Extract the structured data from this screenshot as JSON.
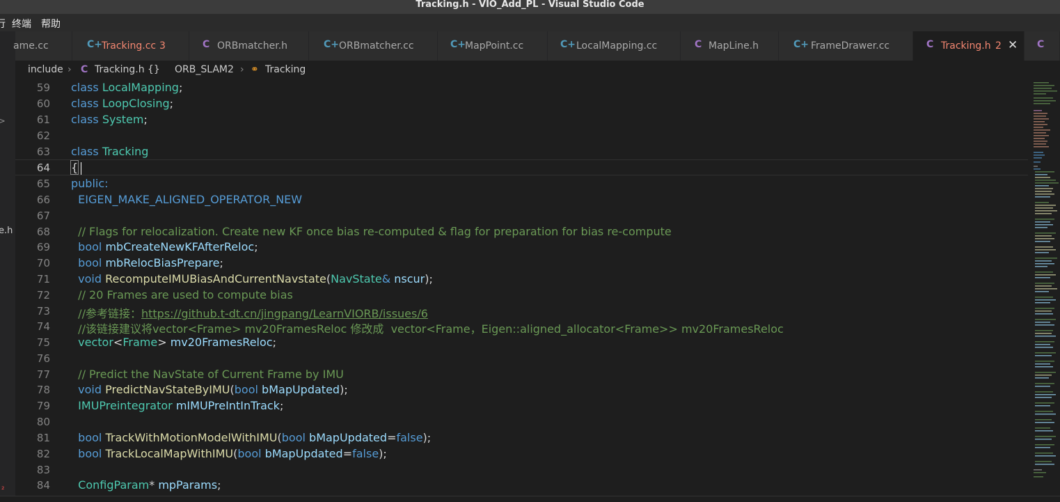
{
  "window": {
    "title": "Tracking.h - VIO_Add_PL - Visual Studio Code"
  },
  "menu": {
    "items": [
      "行",
      "终端",
      "帮助"
    ]
  },
  "left_panel": {
    "fragments": [
      ">",
      "e.h",
      "₂"
    ]
  },
  "tabs": [
    {
      "icon": "",
      "label": "ame.cc",
      "count": ""
    },
    {
      "icon": "C+",
      "label": "Tracking.cc",
      "count": "3"
    },
    {
      "icon": "C",
      "label": "ORBmatcher.h",
      "count": ""
    },
    {
      "icon": "C+",
      "label": "ORBmatcher.cc",
      "count": ""
    },
    {
      "icon": "C+",
      "label": "MapPoint.cc",
      "count": ""
    },
    {
      "icon": "C+",
      "label": "LocalMapping.cc",
      "count": ""
    },
    {
      "icon": "C",
      "label": "MapLine.h",
      "count": ""
    },
    {
      "icon": "C+",
      "label": "FrameDrawer.cc",
      "count": ""
    },
    {
      "icon": "C",
      "label": "Tracking.h",
      "count": "2"
    },
    {
      "icon": "C",
      "label": "",
      "count": ""
    }
  ],
  "breadcrumb": {
    "folder": "include",
    "file_icon": "C",
    "file": "Tracking.h",
    "ns_icon": "{}",
    "namespace": "ORB_SLAM2",
    "class_icon": "⚭",
    "class": "Tracking"
  },
  "editor": {
    "line_numbers": [
      "59",
      "60",
      "61",
      "62",
      "63",
      "64",
      "65",
      "66",
      "67",
      "68",
      "69",
      "70",
      "71",
      "72",
      "73",
      "74",
      "75",
      "76",
      "77",
      "78",
      "79",
      "80",
      "81",
      "82",
      "83",
      "84"
    ],
    "current_line": "64",
    "lines": [
      [
        "class ",
        "LocalMapping",
        ";"
      ],
      [
        "class ",
        "LoopClosing",
        ";"
      ],
      [
        "class ",
        "System",
        ";"
      ],
      [],
      [
        "class ",
        "Tracking"
      ],
      [
        "{"
      ],
      [
        "public:"
      ],
      [
        "  ",
        "EIGEN_MAKE_ALIGNED_OPERATOR_NEW"
      ],
      [],
      [
        "  ",
        "// Flags for relocalization. Create new KF once bias re-computed & flag for preparation for bias re-compute"
      ],
      [
        "  ",
        "bool",
        " ",
        "mbCreateNewKFAfterReloc",
        ";"
      ],
      [
        "  ",
        "bool",
        " ",
        "mbRelocBiasPrepare",
        ";"
      ],
      [
        "  ",
        "void",
        " ",
        "RecomputeIMUBiasAndCurrentNavstate",
        "(",
        "NavState",
        "& ",
        "nscur",
        ");"
      ],
      [
        "  ",
        "// 20 Frames are used to compute bias"
      ],
      [
        "  ",
        "//参考链接：",
        "https://github.t-dt.cn/jingpang/LearnVIORB/issues/6"
      ],
      [
        "  ",
        "//该链接建议将vector<Frame> mv20FramesReloc 修改成  vector<Frame，Eigen::aligned_allocator<Frame>> mv20FramesReloc"
      ],
      [
        "  ",
        "vector",
        "<",
        "Frame",
        "> ",
        "mv20FramesReloc",
        ";"
      ],
      [],
      [
        "  ",
        "// Predict the NavState of Current Frame by IMU"
      ],
      [
        "  ",
        "void",
        " ",
        "PredictNavStateByIMU",
        "(",
        "bool",
        " ",
        "bMapUpdated",
        ");"
      ],
      [
        "  ",
        "IMUPreintegrator",
        " ",
        "mIMUPreIntInTrack",
        ";"
      ],
      [],
      [
        "  ",
        "bool",
        " ",
        "TrackWithMotionModelWithIMU",
        "(",
        "bool",
        " ",
        "bMapUpdated",
        "=",
        "false",
        ");"
      ],
      [
        "  ",
        "bool",
        " ",
        "TrackLocalMapWithIMU",
        "(",
        "bool",
        " ",
        "bMapUpdated",
        "=",
        "false",
        ");"
      ],
      [],
      [
        "  ",
        "ConfigParam",
        "* ",
        "mpParams",
        ";"
      ]
    ]
  },
  "colors": {
    "keyword": "#569cd6",
    "type": "#4ec9b0",
    "function": "#dcdcaa",
    "variable": "#9cdcfe",
    "comment": "#6a9955",
    "tab_modified": "#f48771"
  }
}
